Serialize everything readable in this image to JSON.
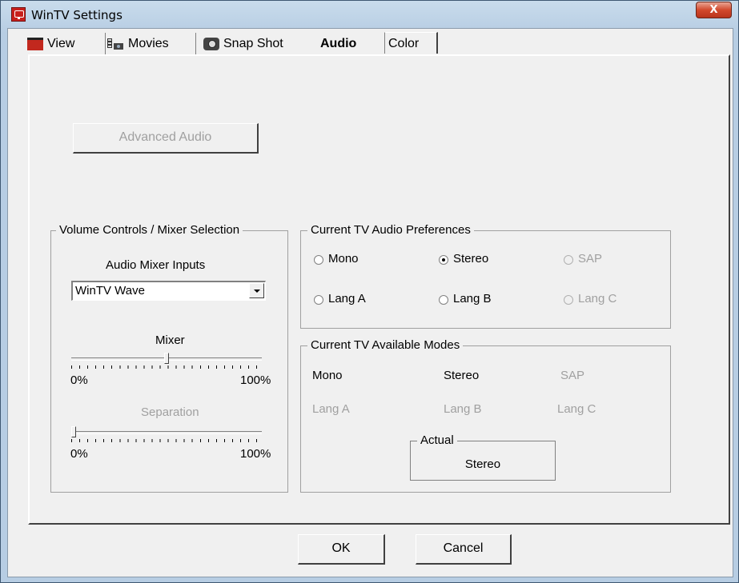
{
  "window": {
    "title": "WinTV Settings",
    "close_label": "X"
  },
  "tabs": [
    {
      "label": "View",
      "icon": "tv-icon",
      "active": false
    },
    {
      "label": "Movies",
      "icon": "film-icon",
      "active": false
    },
    {
      "label": "Snap Shot",
      "icon": "camera-icon",
      "active": false
    },
    {
      "label": "Audio",
      "icon": null,
      "active": true
    },
    {
      "label": "Color",
      "icon": null,
      "active": false
    }
  ],
  "audio": {
    "advanced_button": "Advanced Audio",
    "volume_group": {
      "title": "Volume Controls / Mixer Selection",
      "mixer_inputs_label": "Audio Mixer Inputs",
      "mixer_inputs_value": "WinTV Wave",
      "mixer_label": "Mixer",
      "mixer_value_percent": 50,
      "mixer_min": "0%",
      "mixer_max": "100%",
      "separation_label": "Separation",
      "separation_value_percent": 0,
      "separation_min": "0%",
      "separation_max": "100%"
    },
    "preferences_group": {
      "title": "Current TV Audio Preferences",
      "options": [
        {
          "label": "Mono",
          "checked": false,
          "enabled": true
        },
        {
          "label": "Stereo",
          "checked": true,
          "enabled": true
        },
        {
          "label": "SAP",
          "checked": false,
          "enabled": false
        },
        {
          "label": "Lang A",
          "checked": false,
          "enabled": true
        },
        {
          "label": "Lang B",
          "checked": false,
          "enabled": true
        },
        {
          "label": "Lang C",
          "checked": false,
          "enabled": false
        }
      ]
    },
    "modes_group": {
      "title": "Current TV Available Modes",
      "modes": [
        {
          "label": "Mono",
          "available": true
        },
        {
          "label": "Stereo",
          "available": true
        },
        {
          "label": "SAP",
          "available": false
        },
        {
          "label": "Lang A",
          "available": false
        },
        {
          "label": "Lang B",
          "available": false
        },
        {
          "label": "Lang C",
          "available": false
        }
      ],
      "actual_label": "Actual",
      "actual_value": "Stereo"
    }
  },
  "footer": {
    "ok_label": "OK",
    "cancel_label": "Cancel"
  },
  "colors": {
    "dialog_bg": "#f0f0f0",
    "disabled_text": "#a0a0a0",
    "titlebar": "#b7cde3",
    "close_button": "#d2492c"
  }
}
